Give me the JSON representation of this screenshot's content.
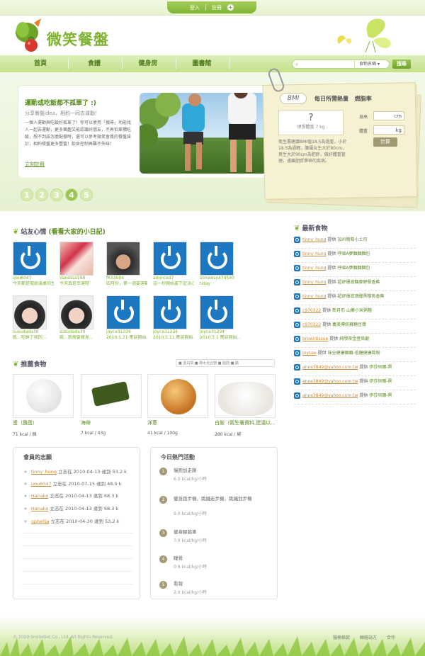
{
  "header": {
    "login_label": "登入",
    "register_label": "註冊",
    "logo_text": "微笑餐盤"
  },
  "nav": {
    "items": [
      "首頁",
      "食譜",
      "健身房",
      "圖書館"
    ]
  },
  "search": {
    "category": "食物名稱",
    "button": "搜尋"
  },
  "hero": {
    "title": "運動或吃飯都不孤單了 :)",
    "subtitle": "分享餐盤idea，相約一同去運動！",
    "body": "一個人運動與吃飯好孤單了！你可以使用「搜尋」功能找人一起去運動，更多樂趣又能認識好朋友，不再怕單獨吃飯，想不到該怎麼配餐時，還可以參考微笑會員的餐盤設計，相約餐盤更多豐富！飲食控制再難不失味！",
    "link": "立刻註冊",
    "pages": [
      "1",
      "2",
      "3",
      "4",
      "5"
    ],
    "active_page": "4"
  },
  "bmi": {
    "chip": "BMI",
    "heading": "每日所需熱量 燃脂率",
    "result": "?",
    "ideal": "理想體重 7 kg",
    "note": "衛生署建議BMI值18.5為過重，小於18.5為過輕，腰圍女生大於80cm，男生大於90cm為肥胖，做好體重管理，遠離肥胖帶來的疾病。",
    "height_label": "身高",
    "height_unit": "cm",
    "weight_label": "體重",
    "weight_unit": "kg",
    "button": "計算"
  },
  "diaries": {
    "title": "站友心情",
    "title_link": "(看看大家的小日記)",
    "items": [
      {
        "user": "uou6047",
        "text": "今天都是擺歌滿桌的生日...",
        "photo": false
      },
      {
        "user": "Vanessa198",
        "text": "今天真是幸運呀",
        "photo": true
      },
      {
        "user": "f633594",
        "text": "四月份，第一週要運動...",
        "photo": true
      },
      {
        "user": "amincxd7",
        "text": "這一秒開始要下定決心...",
        "photo": false
      },
      {
        "user": "sonewso474540",
        "text": "tiday",
        "photo": false
      },
      {
        "user": "susudada30",
        "text": "飢...吃鮮了我的...",
        "photo": true
      },
      {
        "user": "susudada30",
        "text": "飢...我需要瘦身...",
        "photo": true
      },
      {
        "user": "joyce31334",
        "text": "2010.5.21 應該開始...",
        "photo": false
      },
      {
        "user": "joyce31334",
        "text": "2010.5.11 應該開始...",
        "photo": false
      },
      {
        "user": "joyce31334",
        "text": "2010.5.1 應該開始...",
        "photo": false
      }
    ]
  },
  "foods": {
    "title": "推薦食物",
    "legend": "■ 蛋白質  ■ 碳水化合物  ■ 脂肪  ■ 鈉",
    "items": [
      {
        "name": "蛋（雞蛋）",
        "kcal": "71 kcal / 個"
      },
      {
        "name": "海帶",
        "kcal": "7 kcal / 43g"
      },
      {
        "name": "洋蔥",
        "kcal": "41 kcal / 100g"
      },
      {
        "name": "白飯（衛生署資料,建議以...",
        "kcal": "280 kcal / 碗"
      }
    ]
  },
  "goals": {
    "title": "會員的志願",
    "items": [
      {
        "user": "tinny_hung",
        "text": "立志在 2010-04-13 達到 53.2 k"
      },
      {
        "user": "uou6047",
        "text": "立志在 2010-07-15 達到 48.5 k"
      },
      {
        "user": "Hanako",
        "text": "立志在 2010-04-13 達到 68.3 k"
      },
      {
        "user": "Hanako",
        "text": "立志在 2010-04-13 達到 68.3 k"
      },
      {
        "user": "ophellia",
        "text": "立志在 2010-04-30 達到 53.2 k"
      }
    ]
  },
  "activities": {
    "title": "今日熱門活動",
    "items": [
      {
        "num": "1",
        "name": "慢跑加走路",
        "kcal": "6.0 kcal/kg/小時"
      },
      {
        "num": "2",
        "name": "健身跑步機、跳繩走步機、跳繩划步機",
        "kcal": "9.0 kcal/kg/小時"
      },
      {
        "num": "3",
        "name": "健身腳踏車",
        "kcal": "7.0 kcal/kg/小時"
      },
      {
        "num": "4",
        "name": "睡覺",
        "kcal": "0.9 kcal/kg/小時"
      },
      {
        "num": "5",
        "name": "看報",
        "kcal": "2.0 kcal/kg/小時"
      }
    ]
  },
  "latest_foods": {
    "title": "最新食物",
    "items": [
      {
        "user": "tinny_hung",
        "verb": "提供",
        "food": "加州葡萄小土司"
      },
      {
        "user": "tinny_hung",
        "verb": "提供",
        "food": "呼嗆A夢麵麵麵包"
      },
      {
        "user": "tinny_hung",
        "verb": "提供",
        "food": "呼嗆A夢麵麵麵包"
      },
      {
        "user": "tinny_hung",
        "verb": "提供",
        "food": "超舒爆滋麵麥野餐香蕉"
      },
      {
        "user": "tinny_hung",
        "verb": "提供",
        "food": "超舒爆滋酒醺黑櫻桃香蕉"
      },
      {
        "user": "c970322",
        "verb": "提供",
        "food": "新月形 山藥小米粥糧"
      },
      {
        "user": "c970322",
        "verb": "提供",
        "food": "義美傳統蘇糖豆漿"
      },
      {
        "user": "browntissue",
        "verb": "提供",
        "food": "純喫茶金萱烏龍"
      },
      {
        "user": "JoyLee",
        "verb": "提供",
        "food": "味全健康顆顆-低糖健康穀粉"
      },
      {
        "user": "anne3849@yahoo.com.tw",
        "verb": "提供",
        "food": "伊莎貝爾-黑"
      },
      {
        "user": "anne3849@yahoo.com.tw",
        "verb": "提供",
        "food": "伊莎貝爾-黑"
      },
      {
        "user": "anne3849@yahoo.com.tw",
        "verb": "提供",
        "food": "伊莎貝爾-黑"
      }
    ]
  },
  "footer": {
    "copyright": "© 2009 Smilediet Co., Ltd. All Rights Reserved.",
    "links": [
      "服務條款",
      "聯絡站方",
      "合作"
    ]
  }
}
